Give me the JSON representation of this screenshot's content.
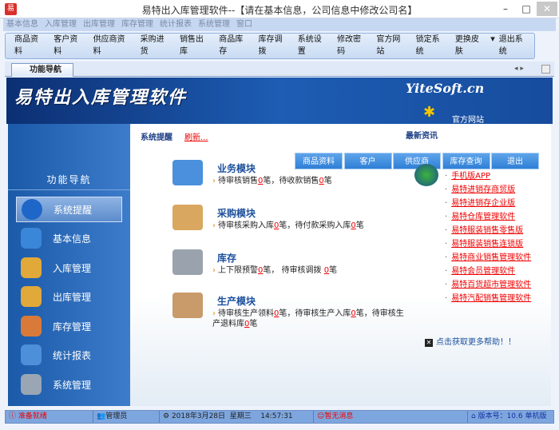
{
  "window": {
    "title": "易特出入库管理软件--【请在基本信息，公司信息中修改公司名】",
    "app_icon": "易",
    "min": "–",
    "max": "□",
    "close": "✕"
  },
  "menu": [
    "基本信息",
    "入库管理",
    "出库管理",
    "库存管理",
    "统计报表",
    "系统管理",
    "窗口"
  ],
  "toolbar": [
    {
      "label": "商品资料",
      "color": "#e99a2c"
    },
    {
      "label": "客户资料",
      "color": "#4aa83a"
    },
    {
      "label": "供应商资料",
      "color": "#5a7fc0"
    },
    {
      "label": "采购进货",
      "color": "#9aa7b6"
    },
    {
      "label": "销售出库",
      "color": "#d9302c"
    },
    {
      "label": "商品库存",
      "color": "#f0b93a"
    },
    {
      "label": "库存调拨",
      "color": "#c9443a"
    },
    {
      "label": "系统设置",
      "color": "#3b6fb8"
    },
    {
      "label": "修改密码",
      "color": "#e3b646"
    },
    {
      "label": "官方网站",
      "color": "#2f83d6"
    },
    {
      "label": "锁定系统",
      "color": "#5e8fcf"
    },
    {
      "label": "更换皮肤",
      "color": "#c84ab0"
    },
    {
      "label": "退出系统",
      "color": "#3c7a3a"
    }
  ],
  "tab": {
    "label": "功能导航"
  },
  "banner": {
    "logo": "易特出入库管理软件",
    "site": "YiteSoft.cn",
    "official": "官方网站"
  },
  "sidebar": {
    "title": "功能导航",
    "items": [
      {
        "label": "系统提醒",
        "color": "#1e66c8"
      },
      {
        "label": "基本信息",
        "color": "#3a86d8"
      },
      {
        "label": "入库管理",
        "color": "#e1a83a"
      },
      {
        "label": "出库管理",
        "color": "#e1a83a"
      },
      {
        "label": "库存管理",
        "color": "#d97a3a"
      },
      {
        "label": "统计报表",
        "color": "#4d8fd8"
      },
      {
        "label": "系统管理",
        "color": "#9aa6b4"
      }
    ]
  },
  "main": {
    "alert": "系统提醒",
    "refresh": "刷新...",
    "news": "最新资讯",
    "quick": [
      "商品资料",
      "客户",
      "供应商",
      "库存查询",
      "退出"
    ],
    "modules": [
      {
        "title": "业务模块",
        "parts": [
          "待审核销售",
          "0",
          "笔，待收款销售",
          "0",
          "笔"
        ],
        "color": "#4a90dc"
      },
      {
        "title": "采购模块",
        "parts": [
          "待审核采购入库",
          "0",
          "笔，待付款采购入库",
          "0",
          "笔"
        ],
        "color": "#d9a760"
      },
      {
        "title": "库存",
        "parts": [
          "上下限预警",
          "0",
          "笔，  待审核调拨 ",
          "0",
          "笔"
        ],
        "color": "#9aa3ad"
      },
      {
        "title": "生产模块",
        "parts": [
          "待审核生产领料",
          "0",
          "笔，待审核生产入库",
          "0",
          "笔，待审核生产退料库",
          "0",
          "笔"
        ],
        "color": "#c99a6a"
      }
    ],
    "links": [
      "手机版APP",
      "易特进销存商贸版",
      "易特进销存企业版",
      "易特仓库管理软件",
      "易特服装销售零售版",
      "易特服装销售连锁版",
      "易特商业销售管理软件",
      "易特会员管理软件",
      "易特百货超市管理软件",
      "易特汽配销售管理软件"
    ],
    "help": "点击获取更多帮助！！"
  },
  "status": {
    "ready": "准备就绪",
    "user": "管理员",
    "date": "2018年3月28日",
    "weekday": "星期三",
    "time": "14:57:31",
    "message": "暂无消息",
    "version": "版本号：10.6 单机版"
  }
}
